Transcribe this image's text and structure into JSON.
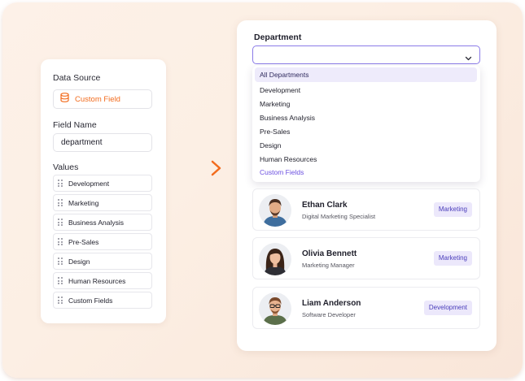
{
  "left_panel": {
    "data_source_label": "Data Source",
    "data_source_value": "Custom Field",
    "data_source_icon": "database-icon",
    "field_name_label": "Field Name",
    "field_name_value": "department",
    "values_label": "Values",
    "values": [
      "Development",
      "Marketing",
      "Business Analysis",
      "Pre-Sales",
      "Design",
      "Human Resources",
      "Custom Fields"
    ]
  },
  "arrow_icon": "arrow-right-icon",
  "right_panel": {
    "department_label": "Department",
    "select_value": "",
    "dropdown_options": [
      "All Departments",
      "Development",
      "Marketing",
      "Business Analysis",
      "Pre-Sales",
      "Design",
      "Human Resources",
      "Custom Fields"
    ],
    "selected_option": "All Departments",
    "users": [
      {
        "name": "Ethan Clark",
        "role": "Digital Marketing Specialist",
        "department": "Marketing"
      },
      {
        "name": "Olivia Bennett",
        "role": "Marketing Manager",
        "department": "Marketing"
      },
      {
        "name": "Liam Anderson",
        "role": "Software Developer",
        "department": "Development"
      }
    ]
  },
  "colors": {
    "accent_orange": "#f26b1d",
    "accent_purple": "#8b7be8",
    "badge_bg": "#ece8fb",
    "badge_text": "#4a3dbb"
  }
}
